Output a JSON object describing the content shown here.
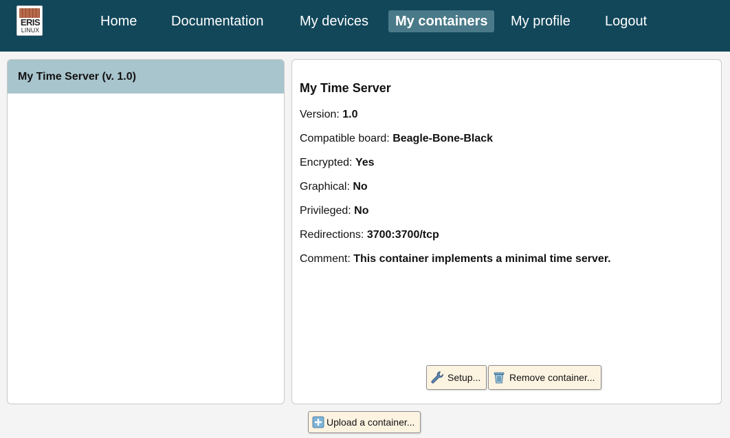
{
  "logo": {
    "line1": "ERIS",
    "line2": "LINUX"
  },
  "nav": {
    "home": "Home",
    "documentation": "Documentation",
    "devices": "My devices",
    "containers": "My containers",
    "profile": "My profile",
    "logout": "Logout"
  },
  "sidebar": {
    "items": [
      {
        "label": "My Time Server (v. 1.0)"
      }
    ]
  },
  "container": {
    "title": "My Time Server",
    "props": [
      {
        "label": "Version:",
        "value": "1.0"
      },
      {
        "label": "Compatible board:",
        "value": "Beagle-Bone-Black"
      },
      {
        "label": "Encrypted:",
        "value": "Yes"
      },
      {
        "label": "Graphical:",
        "value": "No"
      },
      {
        "label": "Privileged:",
        "value": "No"
      },
      {
        "label": "Redirections:",
        "value": "3700:3700/tcp"
      },
      {
        "label": "Comment:",
        "value": "This container implements a minimal time server."
      }
    ],
    "setup_button": "Setup...",
    "remove_button": "Remove container..."
  },
  "upload_button": "Upload a container...",
  "colors": {
    "topbar": "#12475a",
    "active_nav": "#4a7a89",
    "selected_item": "#a8c4cd",
    "button_bg": "#fdf3e1"
  },
  "icons": {
    "setup": "wrench-icon",
    "remove": "trash-icon",
    "upload": "plus-icon"
  }
}
